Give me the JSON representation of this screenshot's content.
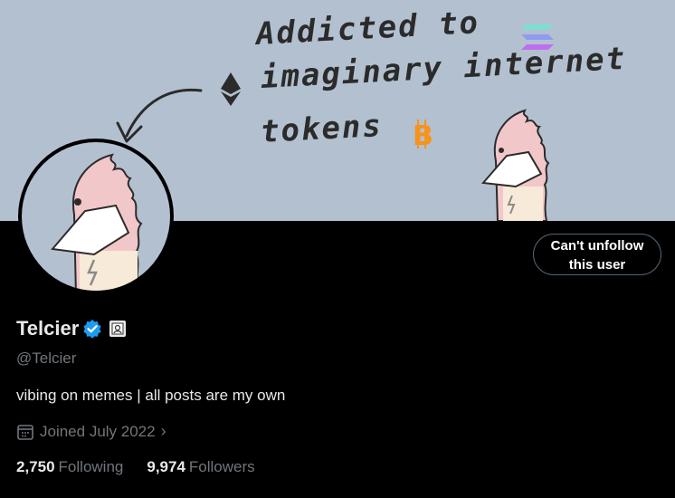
{
  "banner": {
    "line1": "Addicted to",
    "line2": "imaginary internet",
    "line3": "tokens"
  },
  "profile": {
    "name": "Telcier",
    "handle": "@Telcier",
    "bio": "vibing on memes | all posts are my own",
    "joined": "Joined July 2022",
    "following_count": "2,750",
    "following_label": "Following",
    "followers_count": "9,974",
    "followers_label": "Followers"
  },
  "actions": {
    "unfollow_line1": "Can't unfollow",
    "unfollow_line2": "this user"
  },
  "colors": {
    "banner_bg": "#b3c0d0",
    "bird_pink": "#f2c7c9",
    "verified_blue": "#1d9bf0",
    "bitcoin_orange": "#f7931a"
  }
}
